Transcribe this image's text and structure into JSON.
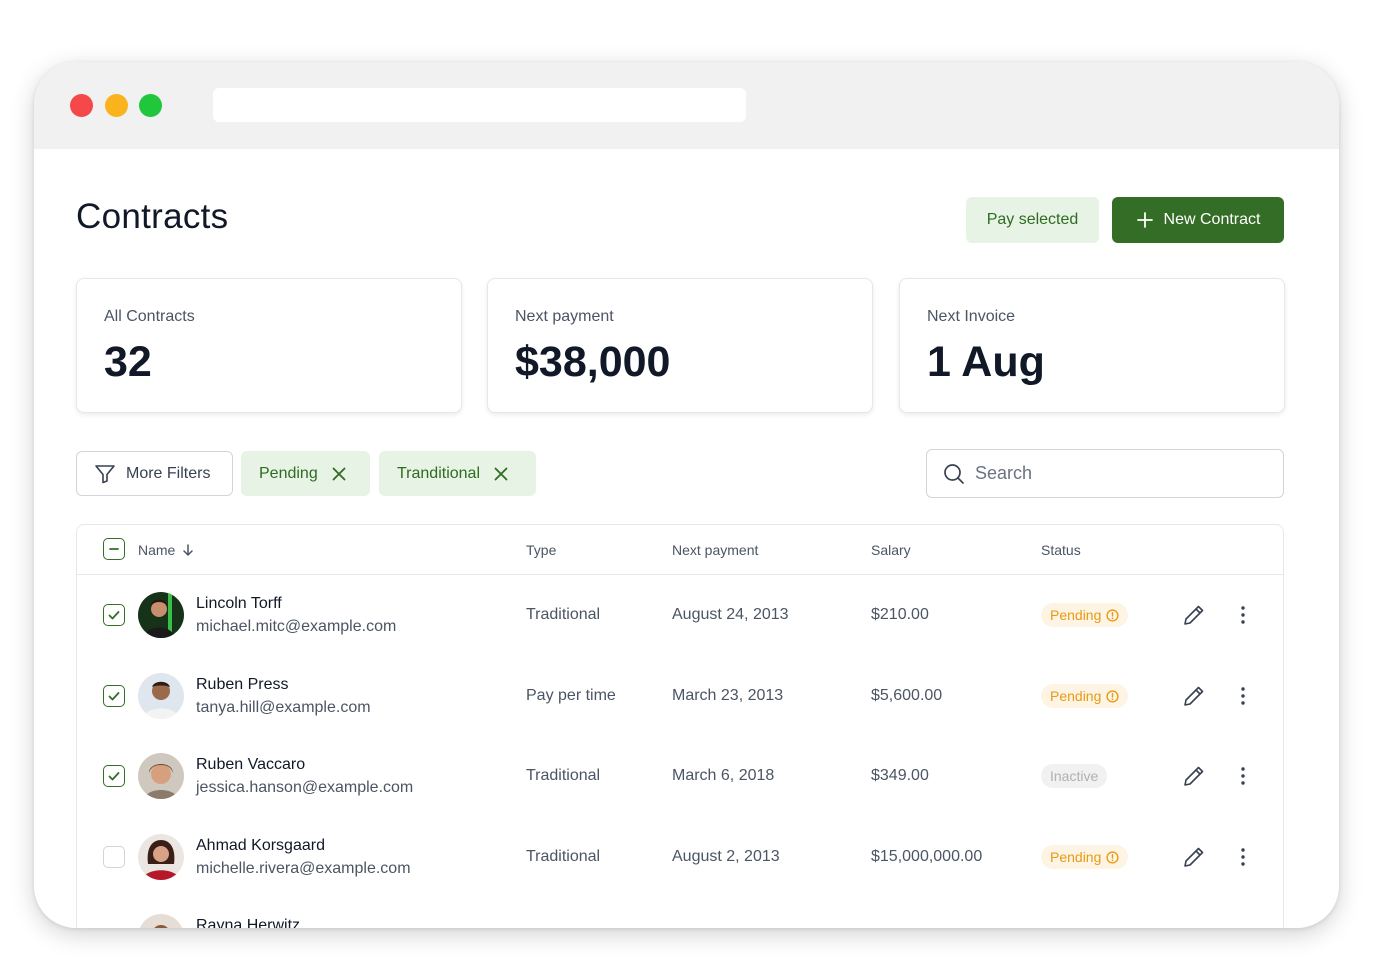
{
  "page": {
    "title": "Contracts",
    "pay_selected": "Pay selected",
    "new_contract": "New Contract"
  },
  "stats": [
    {
      "label": "All Contracts",
      "value": "32"
    },
    {
      "label": "Next payment",
      "value": "$38,000"
    },
    {
      "label": "Next Invoice",
      "value": "1 Aug"
    }
  ],
  "filters": {
    "more_filters": "More Filters",
    "chips": [
      "Pending",
      "Tranditional"
    ]
  },
  "search": {
    "placeholder": "Search"
  },
  "table": {
    "columns": [
      "Name",
      "Type",
      "Next payment",
      "Salary",
      "Status"
    ],
    "rows": [
      {
        "name": "Lincoln Torff",
        "email": "michael.mitc@example.com",
        "type": "Traditional",
        "next_payment": "August 24, 2013",
        "salary": "$210.00",
        "status": "Pending",
        "checked": true
      },
      {
        "name": "Ruben Press",
        "email": "tanya.hill@example.com",
        "type": "Pay per time",
        "next_payment": "March 23, 2013",
        "salary": "$5,600.00",
        "status": "Pending",
        "checked": true
      },
      {
        "name": "Ruben Vaccaro",
        "email": "jessica.hanson@example.com",
        "type": "Traditional",
        "next_payment": "March 6, 2018",
        "salary": "$349.00",
        "status": "Inactive",
        "checked": true
      },
      {
        "name": "Ahmad Korsgaard",
        "email": "michelle.rivera@example.com",
        "type": "Traditional",
        "next_payment": "August 2, 2013",
        "salary": "$15,000,000.00",
        "status": "Pending",
        "checked": false
      },
      {
        "name": "Rayna Herwitz"
      }
    ]
  },
  "colors": {
    "accent": "#336d26",
    "accent_light": "#e7f3e4",
    "pending": "#e89a14",
    "inactive": "#b0b0b0"
  },
  "icons": {
    "filter": "filter-icon",
    "remove_chip": "close-icon",
    "search": "search-icon",
    "sort": "arrow-down-icon",
    "edit": "pencil-icon",
    "more": "more-vertical-icon",
    "status_info": "info-circle-icon"
  }
}
